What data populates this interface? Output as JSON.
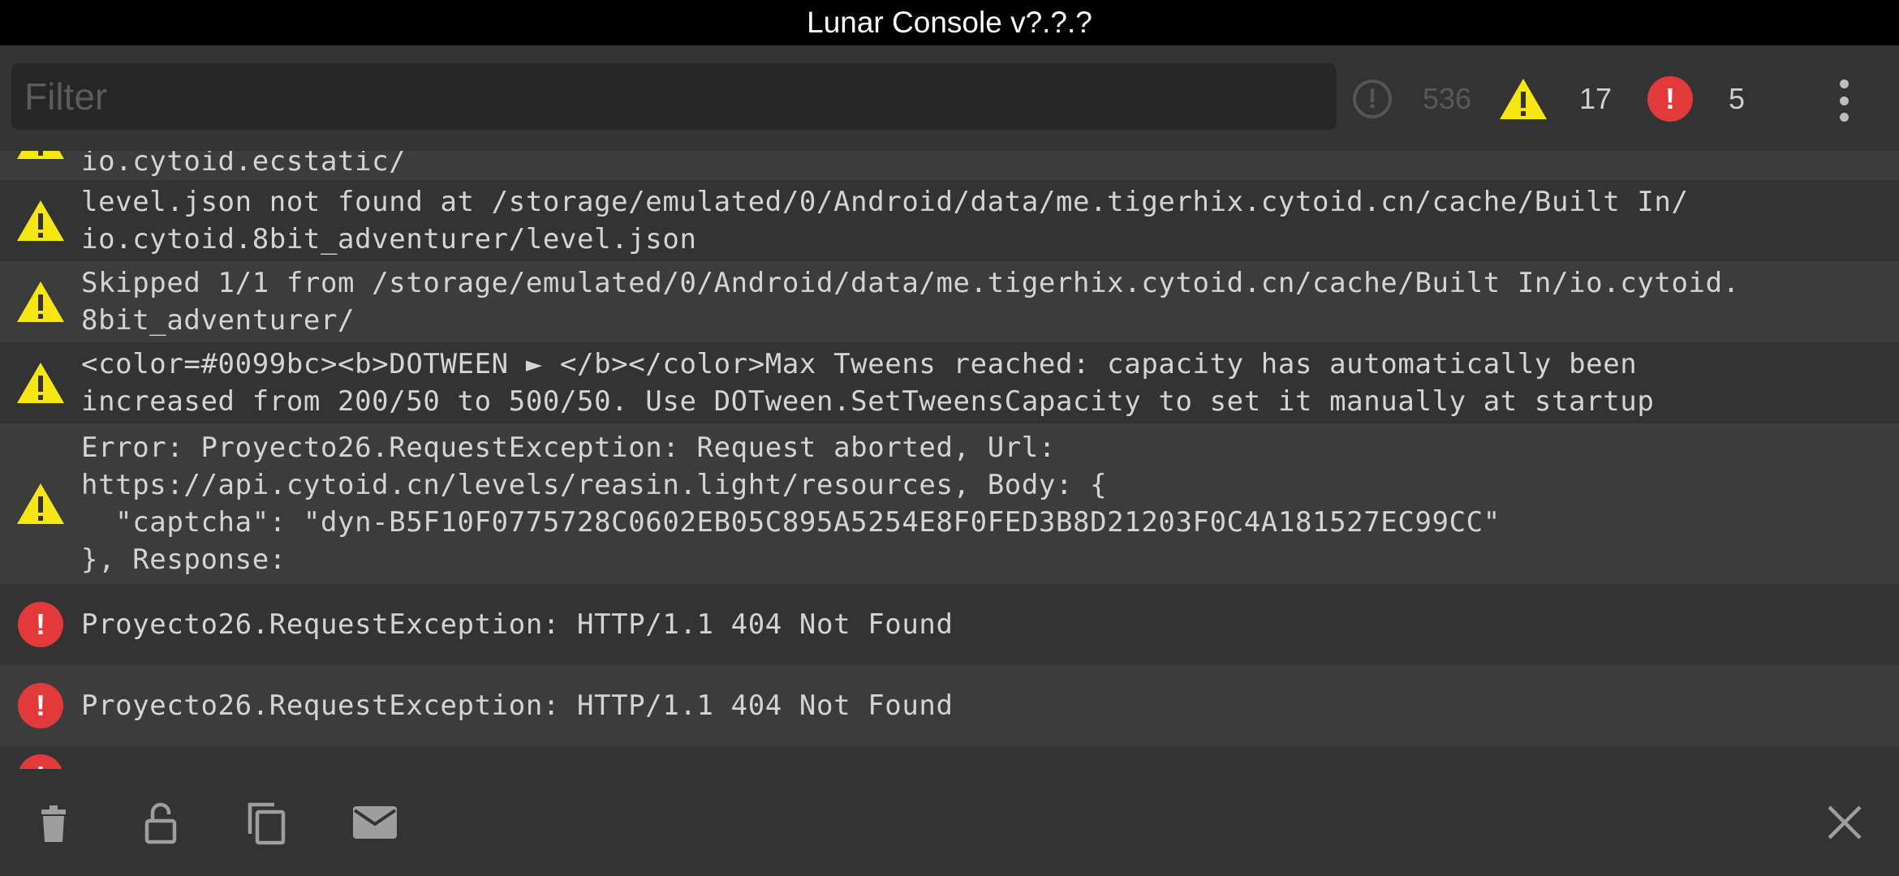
{
  "title": "Lunar Console v?.?.?",
  "filter": {
    "placeholder": "Filter",
    "value": ""
  },
  "counters": {
    "log": {
      "icon": "info-circle-icon",
      "count": "536"
    },
    "warning": {
      "icon": "warning-icon",
      "count": "17"
    },
    "error": {
      "icon": "error-icon",
      "count": "5"
    }
  },
  "entries": [
    {
      "type": "warning",
      "text": "io.cytoid.ecstatic/"
    },
    {
      "type": "warning",
      "text": "level.json not found at /storage/emulated/0/Android/data/me.tigerhix.cytoid.cn/cache/Built In/\nio.cytoid.8bit_adventurer/level.json"
    },
    {
      "type": "warning",
      "text": "Skipped 1/1 from /storage/emulated/0/Android/data/me.tigerhix.cytoid.cn/cache/Built In/io.cytoid.\n8bit_adventurer/"
    },
    {
      "type": "warning",
      "text": "<color=#0099bc><b>DOTWEEN ► </b></color>Max Tweens reached: capacity has automatically been\nincreased from 200/50 to 500/50. Use DOTween.SetTweensCapacity to set it manually at startup"
    },
    {
      "type": "warning",
      "text": "Error: Proyecto26.RequestException: Request aborted, Url:\nhttps://api.cytoid.cn/levels/reasin.light/resources, Body: {\n  \"captcha\": \"dyn-B5F10F0775728C0602EB05C895A5254E8F0FED3B8D21203F0C4A181527EC99CC\"\n}, Response:"
    },
    {
      "type": "error",
      "text": "Proyecto26.RequestException: HTTP/1.1 404 Not Found"
    },
    {
      "type": "error",
      "text": "Proyecto26.RequestException: HTTP/1.1 404 Not Found"
    },
    {
      "type": "error",
      "text": ""
    }
  ],
  "bottom_actions": [
    {
      "name": "clear-button",
      "icon": "trash-icon"
    },
    {
      "name": "lock-button",
      "icon": "unlock-icon"
    },
    {
      "name": "copy-button",
      "icon": "copy-icon"
    },
    {
      "name": "email-button",
      "icon": "mail-icon"
    },
    {
      "name": "close-button",
      "icon": "close-icon"
    }
  ],
  "colors": {
    "warning": "#f5e614",
    "error": "#e23a3a",
    "background": "#363636",
    "titlebar": "#000000"
  }
}
